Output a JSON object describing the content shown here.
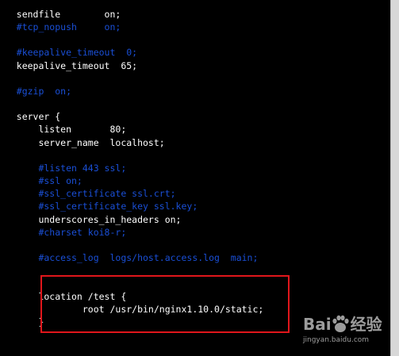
{
  "editor": {
    "lines": [
      {
        "text": "   sendfile        on;",
        "type": "normal"
      },
      {
        "text": "   #tcp_nopush     on;",
        "type": "comment"
      },
      {
        "text": "",
        "type": "normal"
      },
      {
        "text": "   #keepalive_timeout  0;",
        "type": "comment"
      },
      {
        "text": "   keepalive_timeout  65;",
        "type": "normal"
      },
      {
        "text": "",
        "type": "normal"
      },
      {
        "text": "   #gzip  on;",
        "type": "comment"
      },
      {
        "text": "",
        "type": "normal"
      },
      {
        "text": "   server {",
        "type": "normal"
      },
      {
        "text": "       listen       80;",
        "type": "normal"
      },
      {
        "text": "       server_name  localhost;",
        "type": "normal"
      },
      {
        "text": "",
        "type": "normal"
      },
      {
        "text": "       #listen 443 ssl;",
        "type": "comment"
      },
      {
        "text": "       #ssl on;",
        "type": "comment"
      },
      {
        "text": "       #ssl_certificate ssl.crt;",
        "type": "comment"
      },
      {
        "text": "       #ssl_certificate_key ssl.key;",
        "type": "comment"
      },
      {
        "text": "       underscores_in_headers on;",
        "type": "normal"
      },
      {
        "text": "       #charset koi8-r;",
        "type": "comment"
      },
      {
        "text": "",
        "type": "normal"
      },
      {
        "text": "       #access_log  logs/host.access.log  main;",
        "type": "comment"
      },
      {
        "text": "",
        "type": "normal"
      },
      {
        "text": "",
        "type": "normal"
      },
      {
        "text": "       location /test {",
        "type": "normal"
      },
      {
        "text": "               root /usr/bin/nginx1.10.0/static;",
        "type": "normal"
      },
      {
        "text": "       }",
        "type": "normal"
      }
    ]
  },
  "colors": {
    "background": "#000000",
    "text": "#ffffff",
    "comment": "#1a4fd6",
    "highlight_border": "#e0161b",
    "watermark": "#9c9c9c"
  },
  "watermark": {
    "brand_left": "Bai",
    "brand_right": "经验",
    "subtitle": "jingyan.baidu.com",
    "icon": "paw-icon"
  }
}
